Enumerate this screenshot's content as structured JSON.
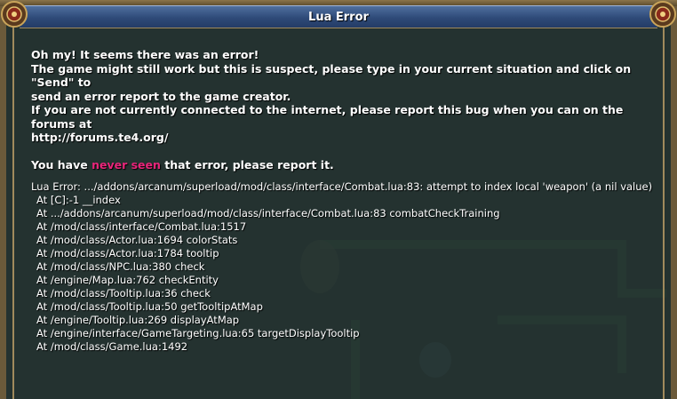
{
  "dialog": {
    "title": "Lua Error"
  },
  "message": {
    "lines": [
      "Oh my! It seems there was an error!",
      "The game might still work but this is suspect, please type in your current situation and click on \"Send\" to",
      "send an error report to the game creator.",
      "If you are not currently connected to the internet, please report this bug when you can on the forums at",
      "http://forums.te4.org/"
    ],
    "notice_before": "You have ",
    "notice_highlight": "never seen",
    "notice_after": " that error, please report it."
  },
  "trace": {
    "error_line": "Lua Error: .../addons/arcanum/superload/mod/class/interface/Combat.lua:83: attempt to index local 'weapon' (a nil value)",
    "frames": [
      "At [C]:-1 __index",
      "At .../addons/arcanum/superload/mod/class/interface/Combat.lua:83 combatCheckTraining",
      "At /mod/class/interface/Combat.lua:1517",
      "At /mod/class/Actor.lua:1694 colorStats",
      "At /mod/class/Actor.lua:1784 tooltip",
      "At /mod/class/NPC.lua:380 check",
      "At /engine/Map.lua:762 checkEntity",
      "At /mod/class/Tooltip.lua:36 check",
      "At /mod/class/Tooltip.lua:50 getTooltipAtMap",
      "At /engine/Tooltip.lua:269 displayAtMap",
      "At /engine/interface/GameTargeting.lua:65 targetDisplayTooltip",
      "At /mod/class/Game.lua:1492"
    ]
  },
  "colors": {
    "highlight": "#e8257a",
    "title_bar": "#2e4a78",
    "frame": "#6b5a3a"
  }
}
